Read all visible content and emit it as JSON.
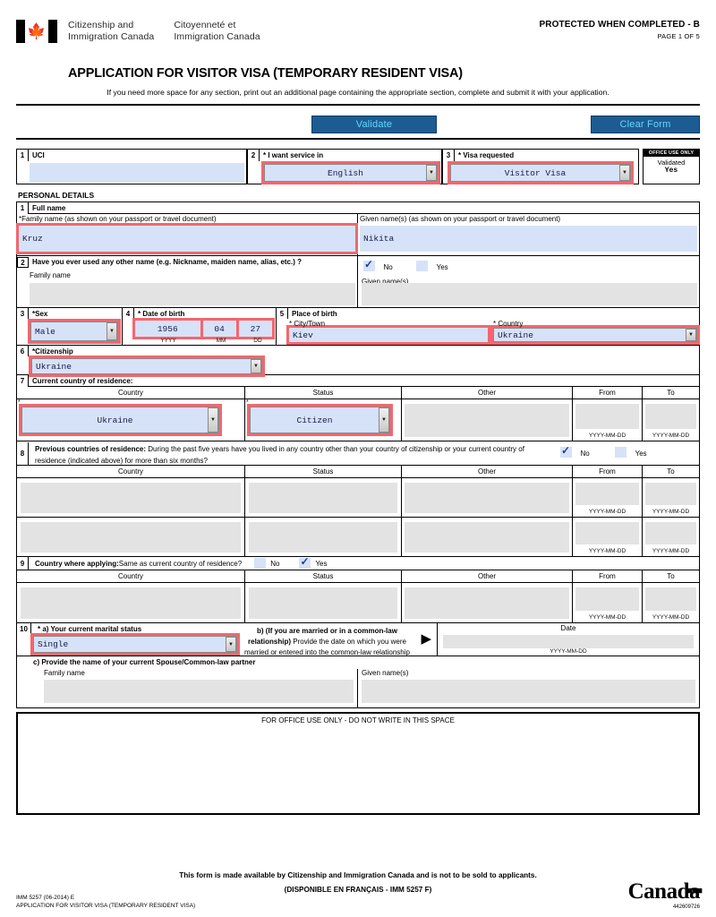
{
  "header": {
    "dept_en_line1": "Citizenship and",
    "dept_en_line2": "Immigration Canada",
    "dept_fr_line1": "Citoyenneté et",
    "dept_fr_line2": "Immigration Canada",
    "protected": "PROTECTED WHEN COMPLETED - B",
    "page_of": "PAGE 1 OF 5",
    "title": "APPLICATION FOR VISITOR VISA (TEMPORARY RESIDENT VISA)",
    "subtitle": "If you need more space for any section, print out an additional page containing the appropriate section, complete and submit it with your application."
  },
  "toolbar": {
    "validate_label": "Validate",
    "clear_label": "Clear Form"
  },
  "top_row": {
    "uci": {
      "num": "1",
      "label": "UCI",
      "value": ""
    },
    "service_in": {
      "num": "2",
      "label": "* I want service in",
      "value": "English"
    },
    "visa_requested": {
      "num": "3",
      "label": "* Visa requested",
      "value": "Visitor Visa"
    },
    "office_use": {
      "title": "OFFICE USE ONLY",
      "line1": "Validated",
      "line2": "Yes"
    }
  },
  "personal_details": {
    "section_title": "PERSONAL DETAILS",
    "full_name": {
      "num": "1",
      "label": "Full name",
      "family_label": "*Family name  (as shown on your passport or travel document)",
      "family_value": "Kruz",
      "given_label": "Given name(s)  (as shown on your passport or travel document)",
      "given_value": "Nikita"
    },
    "other_name": {
      "num": "2",
      "question": "Have you ever used any other name (e.g. Nickname, maiden name, alias, etc.) ?",
      "no_label": "No",
      "yes_label": "Yes",
      "answer": "No",
      "family_label": "Family name",
      "family_value": "",
      "given_label": "Given name(s)",
      "given_value": ""
    },
    "sex": {
      "num": "3",
      "label": "*Sex",
      "value": "Male"
    },
    "dob": {
      "num": "4",
      "label": "* Date of birth",
      "year": "1956",
      "month": "04",
      "day": "27",
      "yyyy": "YYYY",
      "mm": "MM",
      "dd": "DD"
    },
    "place_of_birth": {
      "num": "5",
      "label": "Place of birth",
      "city_label": "* City/Town",
      "city_value": "Kiev",
      "country_label": "* Country",
      "country_value": "Ukraine"
    },
    "citizenship": {
      "num": "6",
      "label": "*Citizenship",
      "value": "Ukraine"
    },
    "current_residence": {
      "num": "7",
      "label": "Current country of residence:",
      "columns": [
        "Country",
        "Status",
        "Other",
        "From",
        "To"
      ],
      "row": {
        "country": "Ukraine",
        "status": "Citizen",
        "other": "",
        "from": "",
        "to": ""
      },
      "date_hint": "YYYY-MM-DD"
    },
    "previous_residence": {
      "num": "8",
      "label_bold": "Previous countries of residence:",
      "label_rest": " During the past five years have you lived in any country other than your country of citizenship or your current country of residence (indicated above) for more than six months?",
      "no_label": "No",
      "yes_label": "Yes",
      "answer": "No",
      "columns": [
        "Country",
        "Status",
        "Other",
        "From",
        "To"
      ],
      "rows": [
        {
          "country": "",
          "status": "",
          "other": "",
          "from": "",
          "to": ""
        },
        {
          "country": "",
          "status": "",
          "other": "",
          "from": "",
          "to": ""
        }
      ],
      "date_hint": "YYYY-MM-DD"
    },
    "country_applying": {
      "num": "9",
      "label_bold": "Country where applying:",
      "label_rest": " Same as current country of residence?",
      "no_label": "No",
      "yes_label": "Yes",
      "answer": "Yes",
      "columns": [
        "Country",
        "Status",
        "Other",
        "From",
        "To"
      ],
      "row": {
        "country": "",
        "status": "",
        "other": "",
        "from": "",
        "to": ""
      },
      "date_hint": "YYYY-MM-DD"
    },
    "marital": {
      "num": "10",
      "a_label": "* a) Your current marital status",
      "a_value": "Single",
      "b_bold": "b) (If you are married or in a common-law relationship)",
      "b_rest": " Provide the date on which you were married or entered into the common-law relationship",
      "date_header": "Date",
      "date_value": "",
      "date_hint": "YYYY-MM-DD",
      "c_label": "c) Provide the name of your current Spouse/Common-law partner",
      "family_label": "Family name",
      "family_value": "",
      "given_label": "Given name(s)",
      "given_value": ""
    }
  },
  "office_block": {
    "caption": "FOR OFFICE USE ONLY - DO NOT WRITE IN THIS SPACE"
  },
  "footer": {
    "line1": "This form is made available by Citizenship and Immigration Canada and is not to be sold to applicants.",
    "line2": "(DISPONIBLE EN FRANÇAIS - IMM 5257 F)",
    "form_id": "IMM 5257 (06-2014) E",
    "form_name": "APPLICATION FOR VISITOR VISA (TEMPORARY RESIDENT VISA)",
    "wordmark": "Canada",
    "doc_number": "442609726"
  }
}
